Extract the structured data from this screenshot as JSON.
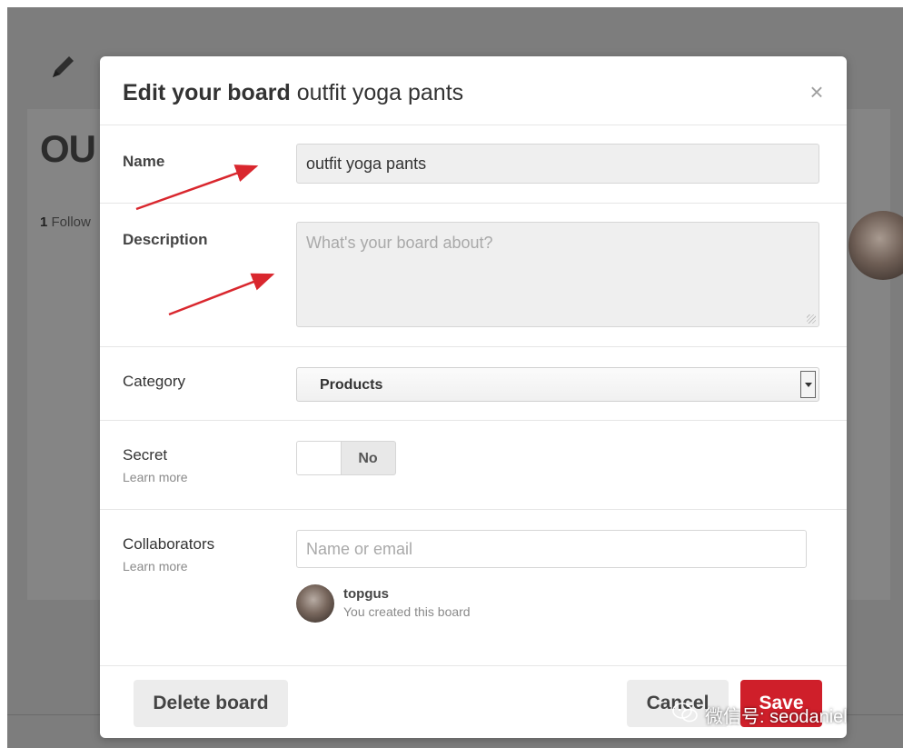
{
  "background": {
    "title": "OU",
    "followers_count": "1",
    "followers_label": "Follow"
  },
  "modal": {
    "title_bold": "Edit your board",
    "title_rest": "outfit yoga pants",
    "close_glyph": "×",
    "fields": {
      "name": {
        "label": "Name",
        "value": "outfit yoga pants"
      },
      "description": {
        "label": "Description",
        "value": "",
        "placeholder": "What's your board about?"
      },
      "category": {
        "label": "Category",
        "selected": "Products"
      },
      "secret": {
        "label": "Secret",
        "learn_more": "Learn more",
        "toggle_value": "No"
      },
      "collaborators": {
        "label": "Collaborators",
        "learn_more": "Learn more",
        "placeholder": "Name or email",
        "members": [
          {
            "name": "topgus",
            "note": "You created this board"
          }
        ]
      }
    },
    "footer": {
      "delete_label": "Delete board",
      "cancel_label": "Cancel",
      "save_label": "Save"
    }
  },
  "watermark": {
    "text": "微信号: seodaniel"
  },
  "colors": {
    "overlay": "#7d7d7d",
    "save_red": "#cf1f2a",
    "annotation_arrow": "#d9272e"
  },
  "icons": [
    "pencil-icon",
    "close-icon",
    "chevron-down-icon",
    "wechat-icon",
    "arrow-annotation"
  ]
}
